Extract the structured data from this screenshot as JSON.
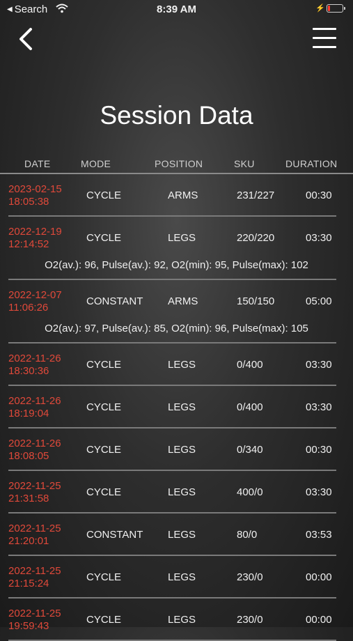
{
  "status_bar": {
    "back_label": "Search",
    "time": "8:39 AM"
  },
  "header": {
    "title": "Session Data"
  },
  "table": {
    "columns": [
      "DATE",
      "MODE",
      "POSITION",
      "SKU",
      "DURATION"
    ],
    "rows": [
      {
        "date": "2023-02-15",
        "time": "18:05:38",
        "mode": "CYCLE",
        "position": "ARMS",
        "sku": "231/227",
        "duration": "00:30",
        "extra": ""
      },
      {
        "date": "2022-12-19",
        "time": "12:14:52",
        "mode": "CYCLE",
        "position": "LEGS",
        "sku": "220/220",
        "duration": "03:30",
        "extra": "O2(av.): 96, Pulse(av.): 92, O2(min): 95, Pulse(max): 102"
      },
      {
        "date": "2022-12-07",
        "time": "11:06:26",
        "mode": "CONSTANT",
        "position": "ARMS",
        "sku": "150/150",
        "duration": "05:00",
        "extra": "O2(av.): 97, Pulse(av.): 85, O2(min): 96, Pulse(max): 105"
      },
      {
        "date": "2022-11-26",
        "time": "18:30:36",
        "mode": "CYCLE",
        "position": "LEGS",
        "sku": "0/400",
        "duration": "03:30",
        "extra": ""
      },
      {
        "date": "2022-11-26",
        "time": "18:19:04",
        "mode": "CYCLE",
        "position": "LEGS",
        "sku": "0/400",
        "duration": "03:30",
        "extra": ""
      },
      {
        "date": "2022-11-26",
        "time": "18:08:05",
        "mode": "CYCLE",
        "position": "LEGS",
        "sku": "0/340",
        "duration": "00:30",
        "extra": ""
      },
      {
        "date": "2022-11-25",
        "time": "21:31:58",
        "mode": "CYCLE",
        "position": "LEGS",
        "sku": "400/0",
        "duration": "03:30",
        "extra": ""
      },
      {
        "date": "2022-11-25",
        "time": "21:20:01",
        "mode": "CONSTANT",
        "position": "LEGS",
        "sku": "80/0",
        "duration": "03:53",
        "extra": ""
      },
      {
        "date": "2022-11-25",
        "time": "21:15:24",
        "mode": "CYCLE",
        "position": "LEGS",
        "sku": "230/0",
        "duration": "00:00",
        "extra": ""
      },
      {
        "date": "2022-11-25",
        "time": "19:59:43",
        "mode": "CYCLE",
        "position": "LEGS",
        "sku": "230/0",
        "duration": "00:00",
        "extra": ""
      }
    ]
  },
  "colors": {
    "date_text": "#e0493a",
    "divider": "#7a7a7a"
  },
  "icons": {
    "back": "chevron-left-icon",
    "menu": "hamburger-menu-icon",
    "wifi": "wifi-icon",
    "battery": "battery-icon"
  }
}
